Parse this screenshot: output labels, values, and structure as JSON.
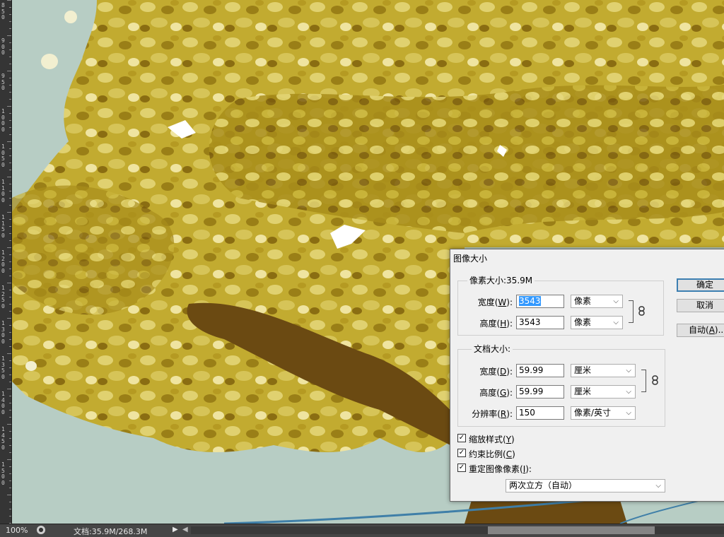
{
  "canvas": {
    "sky_color": "#b7cdc4",
    "foliage_colors": [
      "#a88d1a",
      "#c9b43a",
      "#e3d574",
      "#7c5d0e",
      "#f1e7a6"
    ],
    "trunk_color": "#6b4a12",
    "wire_color": "#3f7fa8"
  },
  "ruler": {
    "labels": [
      "8\n5\n0",
      "9\n0\n0",
      "9\n5\n0",
      "1\n0\n0\n0",
      "1\n0\n5\n0",
      "1\n1\n0\n0",
      "1\n1\n5\n0",
      "1\n2\n0\n0",
      "1\n2\n5\n0",
      "1\n3\n0\n0",
      "1\n3\n5\n0",
      "1\n4\n0\n0",
      "1\n4\n5\n0",
      "1\n5\n0\n0"
    ]
  },
  "status": {
    "zoom": "100%",
    "doc_size": "文档:35.9M/268.3M"
  },
  "dialog": {
    "title": "图像大小",
    "pixel_group": {
      "title": "像素大小:35.9M",
      "width_label": "宽度(",
      "width_key": "W",
      "height_label": "高度(",
      "height_key": "H",
      "label_suffix": "):",
      "width_value": "3543",
      "height_value": "3543",
      "width_unit": "像素",
      "height_unit": "像素"
    },
    "doc_group": {
      "title": "文档大小:",
      "width_label": "宽度(",
      "width_key": "D",
      "height_label": "高度(",
      "height_key": "G",
      "res_label": "分辨率(",
      "res_key": "R",
      "label_suffix": "):",
      "width_value": "59.99",
      "height_value": "59.99",
      "res_value": "150",
      "width_unit": "厘米",
      "height_unit": "厘米",
      "res_unit": "像素/英寸"
    },
    "buttons": {
      "ok": "确定",
      "cancel": "取消",
      "auto": "自动(",
      "auto_key": "A",
      "auto_suffix": ")..."
    },
    "checkboxes": {
      "scale_styles": "缩放样式(",
      "scale_styles_key": "Y",
      "constrain": "约束比例(",
      "constrain_key": "C",
      "resample": "重定图像像素(",
      "resample_key": "I",
      "close_paren": ")",
      "resample_suffix": "):",
      "checked": [
        true,
        true,
        true
      ]
    },
    "resample_method": "两次立方（自动）"
  }
}
